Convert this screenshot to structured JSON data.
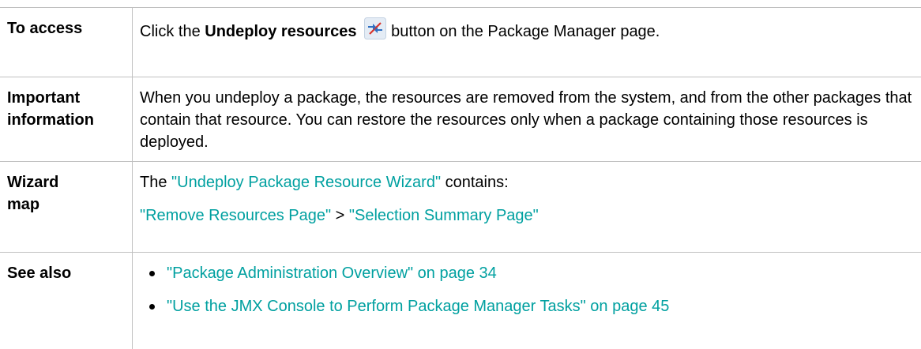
{
  "rows": {
    "access": {
      "label": "To access",
      "prefix": "Click the ",
      "bold": "Undeploy resources",
      "icon": "undeploy-resources-icon",
      "suffix": "button on the Package Manager page."
    },
    "important": {
      "label_line1": "Important",
      "label_line2": "information",
      "text": "When you undeploy a package, the resources are removed from the system, and from the other packages that contain that resource. You can restore the resources only when a package containing those resources is deployed."
    },
    "wizard": {
      "label_line1": "Wizard",
      "label_line2": "map",
      "line1_prefix": "The ",
      "line1_link": "\"Undeploy Package Resource Wizard\"",
      "line1_suffix": " contains:",
      "link_a": "\"Remove Resources Page\"",
      "separator": " > ",
      "link_b": "\"Selection Summary Page\""
    },
    "see_also": {
      "label": "See also",
      "items": [
        "\"Package Administration Overview\" on page 34",
        "\"Use the JMX Console to Perform Package Manager Tasks\" on page 45"
      ]
    }
  },
  "colors": {
    "link": "#00a0a0",
    "border": "#c0c0c0"
  }
}
